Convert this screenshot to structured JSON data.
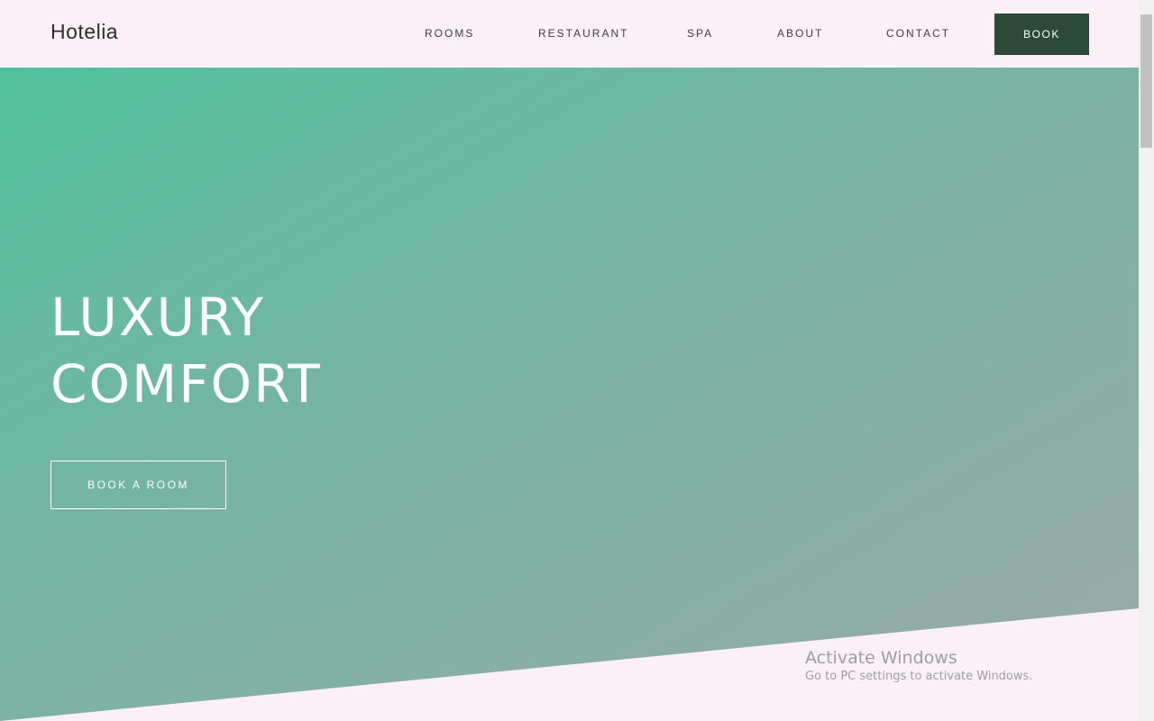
{
  "header": {
    "logo": "Hotelia",
    "nav": [
      "ROOMS",
      "RESTAURANT",
      "SPA",
      "ABOUT",
      "CONTACT"
    ],
    "book_label": "BOOK"
  },
  "hero": {
    "title_line1": "LUXURY",
    "title_line2": "COMFORT",
    "cta_label": "BOOK A ROOM"
  },
  "os_watermark": {
    "title": "Activate Windows",
    "subtitle": "Go to PC settings to activate Windows."
  },
  "colors": {
    "page_background": "#fbf0f6",
    "hero_gradient_start": "#52c29c",
    "hero_gradient_end": "#9aaaa6",
    "book_button": "#2b4a38",
    "hero_text": "#ffffff"
  }
}
